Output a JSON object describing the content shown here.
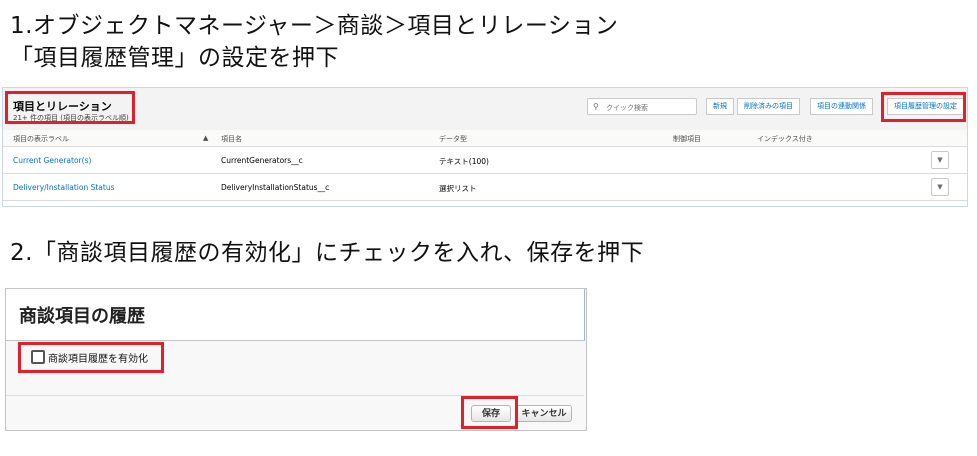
{
  "instructions": {
    "step1_line1": "1.オブジェクトマネージャー＞商談＞項目とリレーション",
    "step1_line2": "「項目履歴管理」の設定を押下",
    "step2": "2.「商談項目履歴の有効化」にチェックを入れ、保存を押下"
  },
  "fields_panel": {
    "title": "項目とリレーション",
    "subtitle": "21+ 件の項目 (項目の表示ラベル順)",
    "search_placeholder": "クイック検索",
    "buttons": [
      "新規",
      "削除済みの項目",
      "項目の連動関係",
      "項目履歴管理の設定"
    ],
    "columns": [
      "項目の表示ラベル",
      "項目名",
      "データ型",
      "制御項目",
      "インデックス付き"
    ],
    "sort_indicator": "▲",
    "rows": [
      {
        "label": "Current Generator(s)",
        "api_name": "CurrentGenerators__c",
        "type": "テキスト(100)"
      },
      {
        "label": "Delivery/Installation Status",
        "api_name": "DeliveryInstallationStatus__c",
        "type": "選択リスト"
      }
    ],
    "row_menu_icon": "▼"
  },
  "history_panel": {
    "title": "商談項目の履歴",
    "checkbox_label": "商談項目履歴を有効化",
    "checkbox_checked": false,
    "save_label": "保存",
    "cancel_label": "キャンセル"
  },
  "colors": {
    "highlight": "#e0202a",
    "link": "#0070d2"
  }
}
